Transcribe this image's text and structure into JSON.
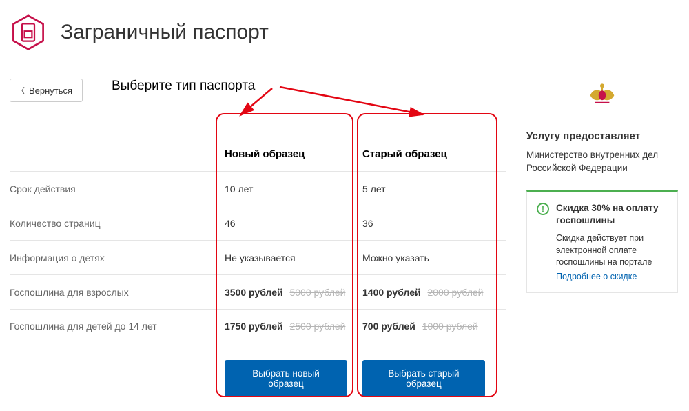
{
  "page": {
    "title": "Заграничный паспорт"
  },
  "back": {
    "label": "Вернуться"
  },
  "annotation": {
    "label": "Выберите тип паспорта"
  },
  "table": {
    "headers": {
      "new": "Новый образец",
      "old": "Старый образец"
    },
    "rows": {
      "validity": {
        "label": "Срок действия",
        "new": "10 лет",
        "old": "5 лет"
      },
      "pages": {
        "label": "Количество страниц",
        "new": "46",
        "old": "36"
      },
      "children": {
        "label": "Информация о детях",
        "new": "Не указывается",
        "old": "Можно указать"
      },
      "fee_adult": {
        "label": "Госпошлина для взрослых",
        "new": {
          "price": "3500 рублей",
          "old_price": "5000 рублей"
        },
        "old": {
          "price": "1400 рублей",
          "old_price": "2000 рублей"
        }
      },
      "fee_child": {
        "label": "Госпошлина для детей до 14 лет",
        "new": {
          "price": "1750 рублей",
          "old_price": "2500 рублей"
        },
        "old": {
          "price": "700 рублей",
          "old_price": "1000 рублей"
        }
      }
    },
    "actions": {
      "new": "Выбрать новый образец",
      "old": "Выбрать старый образец"
    }
  },
  "provider": {
    "section_title": "Услугу предоставляет",
    "name": "Министерство внутренних дел Российской Федерации"
  },
  "discount": {
    "title": "Скидка 30% на оплату госпошлины",
    "text": "Скидка действует при электронной оплате госпошлины на портале",
    "link": "Подробнее о скидке"
  },
  "colors": {
    "accent_red": "#e30613",
    "blue": "#0063b0",
    "green": "#4caf50"
  }
}
